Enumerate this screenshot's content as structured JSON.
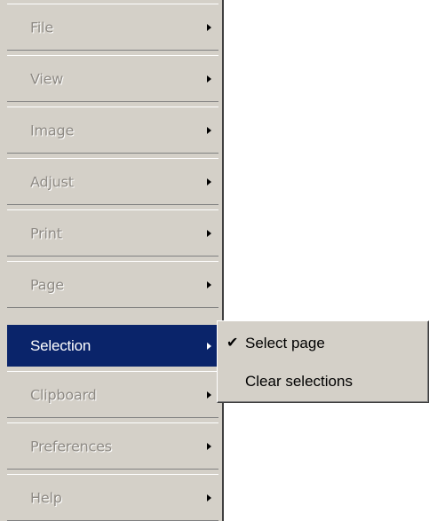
{
  "menu": {
    "items": [
      {
        "label": "File"
      },
      {
        "label": "View"
      },
      {
        "label": "Image"
      },
      {
        "label": "Adjust"
      },
      {
        "label": "Print"
      },
      {
        "label": "Page"
      },
      {
        "label": "Selection"
      },
      {
        "label": "Clipboard"
      },
      {
        "label": "Preferences"
      },
      {
        "label": "Help"
      }
    ],
    "active_item": "Selection"
  },
  "submenu": {
    "items": [
      {
        "label": "Select page",
        "checked": true,
        "check_glyph": "✔"
      },
      {
        "label": "Clear selections",
        "checked": false
      }
    ]
  },
  "colors": {
    "menu_background": "#d4d0c8",
    "highlight_background": "#0a246a",
    "highlight_text": "#ffffff",
    "disabled_text": "#8e8a84"
  }
}
